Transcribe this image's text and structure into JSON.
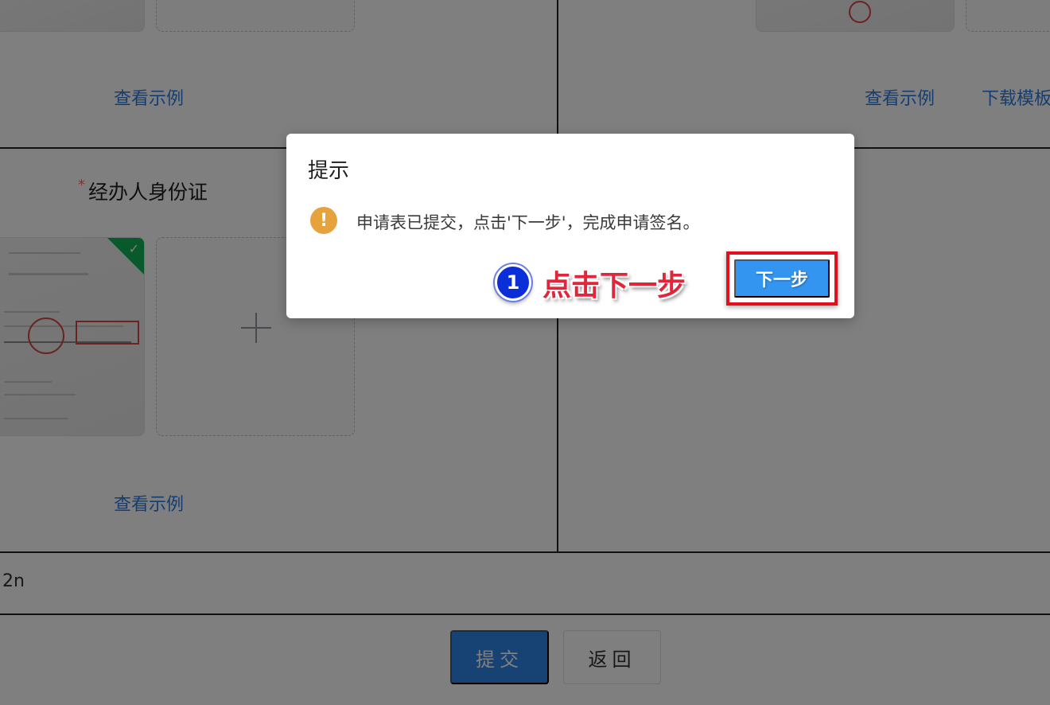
{
  "form": {
    "links": {
      "view_example": "查看示例",
      "download_template": "下载模板"
    },
    "agent_id_field": {
      "required_mark": "*",
      "label": "经办人身份证"
    },
    "note_text": "2n",
    "submit_label": "提交",
    "back_label": "返回",
    "upload_slot_icon": "plus-icon"
  },
  "dialog": {
    "title": "提示",
    "icon": "warning-icon",
    "message": "申请表已提交，点击'下一步'，完成申请签名。",
    "next_label": "下一步",
    "annotation": {
      "step_number": "1",
      "text": "点击下一步"
    }
  },
  "colors": {
    "accent": "#2e86e8",
    "warning": "#e6a23c",
    "annotation_red": "#e0263a",
    "success_badge": "#13b555"
  }
}
